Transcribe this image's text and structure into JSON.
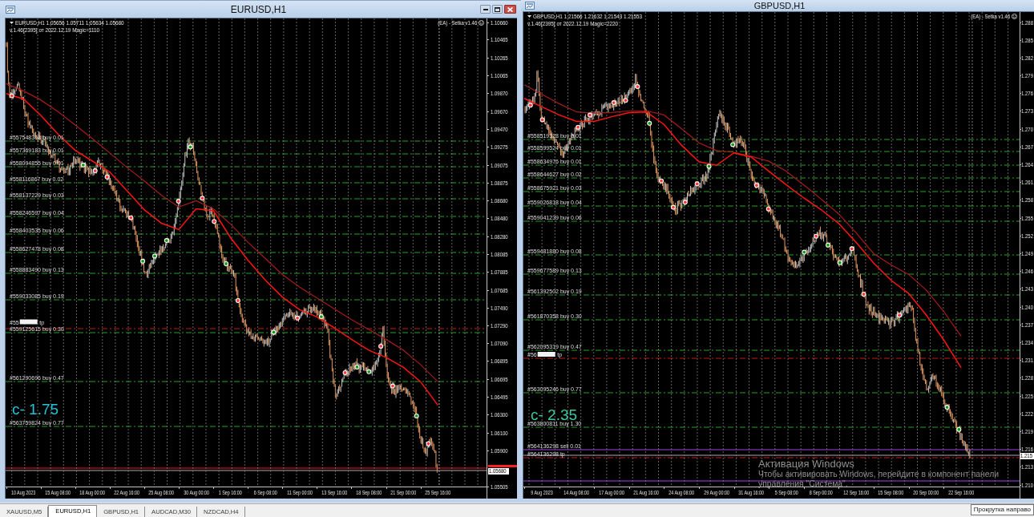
{
  "windows": [
    {
      "title": "EURUSD,H1",
      "buttons": [
        {
          "kind": "minimize"
        },
        {
          "kind": "maximize"
        },
        {
          "kind": "close"
        }
      ],
      "chart": {
        "header": "EURUSD,H1 1.05656 1.05711 1.05634 1.05680",
        "subheader": "v.1.46[2395] от 2022.12.19 Magic=1110",
        "expert": "(EA) - Setka v1.46",
        "counter": {
          "text": "c- 1.75",
          "color": "#20c4d6"
        },
        "current_price": "1.05680",
        "levels": [
          {
            "kind": "buy",
            "label": "#557548303 buy 0.01"
          },
          {
            "kind": "buy",
            "label": "#557369183 buy 0.01"
          },
          {
            "kind": "buy",
            "label": "#558094855 buy 0.01"
          },
          {
            "kind": "buy",
            "label": "#558116867 buy 0.02"
          },
          {
            "kind": "buy",
            "label": "#558137229 buy 0.03"
          },
          {
            "kind": "buy",
            "label": "#558246597 buy 0.04"
          },
          {
            "kind": "buy",
            "label": "#558403535 buy 0.06"
          },
          {
            "kind": "buy",
            "label": "#558627478 buy 0.08"
          },
          {
            "kind": "buy",
            "label": "#558883490 buy 0.13"
          },
          {
            "kind": "buy",
            "label": "#559033085 buy 0.19"
          },
          {
            "kind": "tp",
            "label": "#55",
            "overprinted": true,
            "suffix": "tp"
          },
          {
            "kind": "buy",
            "label": "#559125615 buy 0.30"
          },
          {
            "kind": "buy",
            "label": "#561290696 buy 0.47"
          },
          {
            "kind": "buy",
            "label": "#563759824 buy 0.77"
          },
          {
            "kind": "stop"
          }
        ],
        "chart_data": {
          "type": "line",
          "grid": true,
          "ylim": [
            1.05505,
            1.10705
          ],
          "categories": [
            null,
            "10 Aug 2023",
            null,
            "15 Aug 08:00",
            null,
            "18 Aug 00:00",
            null,
            "22 Aug 16:00",
            null,
            "25 Aug 08:00",
            null,
            "30 Aug 00:00",
            null,
            "1 Sep 16:00",
            null,
            "6 Sep 08:00",
            null,
            "11 Sep 00:00",
            null,
            "13 Sep 16:00",
            null,
            "18 Sep 08:00",
            null,
            "21 Sep 00:00",
            null,
            "25 Sep 16:00"
          ],
          "yticks": [
            {
              "value": 1.1066,
              "label": "1.10660"
            },
            {
              "value": 1.10465,
              "label": "1.10465"
            },
            {
              "value": 1.10265,
              "label": "1.10265"
            },
            {
              "value": 1.10065,
              "label": "1.10065"
            },
            {
              "value": 1.0987,
              "label": "1.09870"
            },
            {
              "value": 1.0967,
              "label": "1.09670"
            },
            {
              "value": 1.0947,
              "label": "1.09470"
            },
            {
              "value": 1.09275,
              "label": "1.09275"
            },
            {
              "value": 1.09075,
              "label": "1.09075"
            },
            {
              "value": 1.08875,
              "label": "1.08875"
            },
            {
              "value": 1.0868,
              "label": "1.08680"
            },
            {
              "value": 1.0848,
              "label": "1.08480"
            },
            {
              "value": 1.0828,
              "label": "1.08280"
            },
            {
              "value": 1.08085,
              "label": "1.08085"
            },
            {
              "value": 1.07885,
              "label": "1.07885"
            },
            {
              "value": 1.07685,
              "label": "1.07685"
            },
            {
              "value": 1.0749,
              "label": "1.07490"
            },
            {
              "value": 1.0729,
              "label": "1.07290"
            },
            {
              "value": 1.0709,
              "label": "1.07090"
            },
            {
              "value": 1.06895,
              "label": "1.06895"
            },
            {
              "value": 1.06695,
              "label": "1.06695"
            },
            {
              "value": 1.06495,
              "label": "1.06495"
            },
            {
              "value": 1.063,
              "label": "1.06300"
            },
            {
              "value": 1.061,
              "label": "1.06100"
            },
            {
              "value": 1.059,
              "label": "1.05900"
            },
            {
              "value": 1.05505,
              "label": "1.05505"
            }
          ],
          "series": [
            {
              "color": "#a61c1c",
              "values": [
                1.0998,
                1.099,
                1.098,
                1.0967,
                1.0952,
                1.0937,
                1.0921,
                1.0905,
                1.089,
                1.0874,
                1.0861,
                1.0868,
                1.0859,
                1.0842,
                1.0822,
                1.0804,
                1.0786,
                1.0772,
                1.076,
                1.0748,
                1.0736,
                1.0725,
                1.0714,
                1.0702,
                1.0686,
                1.0667
              ]
            },
            {
              "color": "#ff1414",
              "values": [
                1.0987,
                1.0981,
                1.0963,
                1.0942,
                1.0924,
                1.0912,
                1.09,
                1.0879,
                1.0858,
                1.0843,
                1.0836,
                1.0859,
                1.0857,
                1.0827,
                1.0802,
                1.078,
                1.0761,
                1.0747,
                1.0739,
                1.0727,
                1.0714,
                1.0702,
                1.0694,
                1.0683,
                1.0667,
                1.0641
              ]
            }
          ]
        }
      }
    },
    {
      "title": "GBPUSD,H1",
      "chart": {
        "header": "GBPUSD,H1 1.21566 1.21632 1.21543 1.21553",
        "subheader": "v.1.46[2395] от 2022.12.19 Magic=2220",
        "expert": "(EA) - Setka v1.46",
        "counter": {
          "text": "c- 2.35",
          "color": "#3cc8a0"
        },
        "current_price": "1.215",
        "levels": [
          {
            "kind": "buy",
            "label": "#558519328 buy 0.01"
          },
          {
            "kind": "buy",
            "label": "#558599524 buy 0.01"
          },
          {
            "kind": "buy",
            "label": "#558634976 buy 0.01"
          },
          {
            "kind": "buy",
            "label": "#558644627 buy 0.02"
          },
          {
            "kind": "buy",
            "label": "#558675921 buy 0.03"
          },
          {
            "kind": "buy",
            "label": "#559026818 buy 0.04"
          },
          {
            "kind": "buy",
            "label": "#559041239 buy 0.06"
          },
          {
            "kind": "buy",
            "label": "#559481880 buy 0.08"
          },
          {
            "kind": "buy",
            "label": "#559677589 buy 0.13"
          },
          {
            "kind": "buy",
            "label": "#561392502 buy 0.19"
          },
          {
            "kind": "buy",
            "label": "#561870358 buy 0.30"
          },
          {
            "kind": "buy",
            "label": "#562095319 buy 0.47"
          },
          {
            "kind": "tp",
            "label": "#56",
            "overprinted": true,
            "suffix": "tp"
          },
          {
            "kind": "buy",
            "label": "#563095246 buy 0.77"
          },
          {
            "kind": "buy",
            "label": "#563800811 buy 1.30"
          },
          {
            "kind": "sell",
            "label": "#564136298 sell 0.01"
          },
          {
            "kind": "tp",
            "label": "#564136298 tp",
            "overprinted": false
          },
          {
            "kind": "sell"
          }
        ],
        "chart_data": {
          "type": "line",
          "grid": true,
          "ylim": [
            1.20973,
            1.28976
          ],
          "categories": [
            null,
            "9 Aug 2023",
            null,
            "14 Aug 08:00",
            null,
            "17 Aug 00:00",
            null,
            "21 Aug 16:00",
            null,
            "24 Aug 08:00",
            null,
            "29 Aug 00:00",
            null,
            "31 Aug 16:00",
            null,
            "5 Sep 08:00",
            null,
            "8 Sep 00:00",
            null,
            "12 Sep 16:00",
            null,
            "15 Sep 08:00",
            null,
            "20 Sep 00:00",
            null,
            "22 Sep 16:00"
          ],
          "yticks": [
            {
              "value": 1.288,
              "label": "1.288"
            },
            {
              "value": 1.285,
              "label": "1.285"
            },
            {
              "value": 1.282,
              "label": "1.282"
            },
            {
              "value": 1.279,
              "label": "1.279"
            },
            {
              "value": 1.276,
              "label": "1.276"
            },
            {
              "value": 1.273,
              "label": "1.273"
            },
            {
              "value": 1.27,
              "label": "1.270"
            },
            {
              "value": 1.267,
              "label": "1.267"
            },
            {
              "value": 1.264,
              "label": "1.264"
            },
            {
              "value": 1.261,
              "label": "1.261"
            },
            {
              "value": 1.258,
              "label": "1.258"
            },
            {
              "value": 1.255,
              "label": "1.255"
            },
            {
              "value": 1.252,
              "label": "1.252"
            },
            {
              "value": 1.249,
              "label": "1.249"
            },
            {
              "value": 1.246,
              "label": "1.246"
            },
            {
              "value": 1.243,
              "label": "1.243"
            },
            {
              "value": 1.24,
              "label": "1.240"
            },
            {
              "value": 1.237,
              "label": "1.237"
            },
            {
              "value": 1.234,
              "label": "1.234"
            },
            {
              "value": 1.231,
              "label": "1.231"
            },
            {
              "value": 1.228,
              "label": "1.228"
            },
            {
              "value": 1.225,
              "label": "1.225"
            },
            {
              "value": 1.222,
              "label": "1.222"
            },
            {
              "value": 1.219,
              "label": "1.219"
            },
            {
              "value": 1.216,
              "label": "1.216"
            },
            {
              "value": 1.213,
              "label": "1.213"
            },
            {
              "value": 1.21,
              "label": "1.210"
            }
          ],
          "series": [
            {
              "color": "#a61c1c",
              "values": [
                1.2775,
                1.2759,
                1.2743,
                1.2729,
                1.2727,
                1.2728,
                1.2731,
                1.2731,
                1.2724,
                1.2701,
                1.2677,
                1.2664,
                1.2661,
                1.2654,
                1.2646,
                1.2629,
                1.2606,
                1.2582,
                1.2557,
                1.2525,
                1.249,
                1.2471,
                1.2455,
                1.2429,
                1.2393,
                1.2351
              ]
            },
            {
              "color": "#ff1414",
              "values": [
                1.2752,
                1.2738,
                1.2724,
                1.2713,
                1.2713,
                1.2721,
                1.2728,
                1.2729,
                1.2708,
                1.2673,
                1.2645,
                1.2639,
                1.266,
                1.2653,
                1.2629,
                1.2606,
                1.2584,
                1.2564,
                1.2541,
                1.2509,
                1.2474,
                1.2445,
                1.2423,
                1.2387,
                1.2345,
                1.2298
              ]
            }
          ]
        }
      }
    }
  ],
  "tabs": [
    {
      "label": "XAUUSD,M5",
      "selected": false
    },
    {
      "label": "EURUSD,H1",
      "selected": true
    },
    {
      "label": "GBPUSD,H1",
      "selected": false
    },
    {
      "label": "AUDCAD,M30",
      "selected": false
    },
    {
      "label": "NZDCAD,H4",
      "selected": false
    }
  ],
  "tooltip": "Прокрутка направо",
  "activation_notice": {
    "title": "Активация Windows",
    "lines": [
      "Чтобы активировать Windows, перейдите в компонент панели",
      "управления \"Система\"."
    ]
  }
}
